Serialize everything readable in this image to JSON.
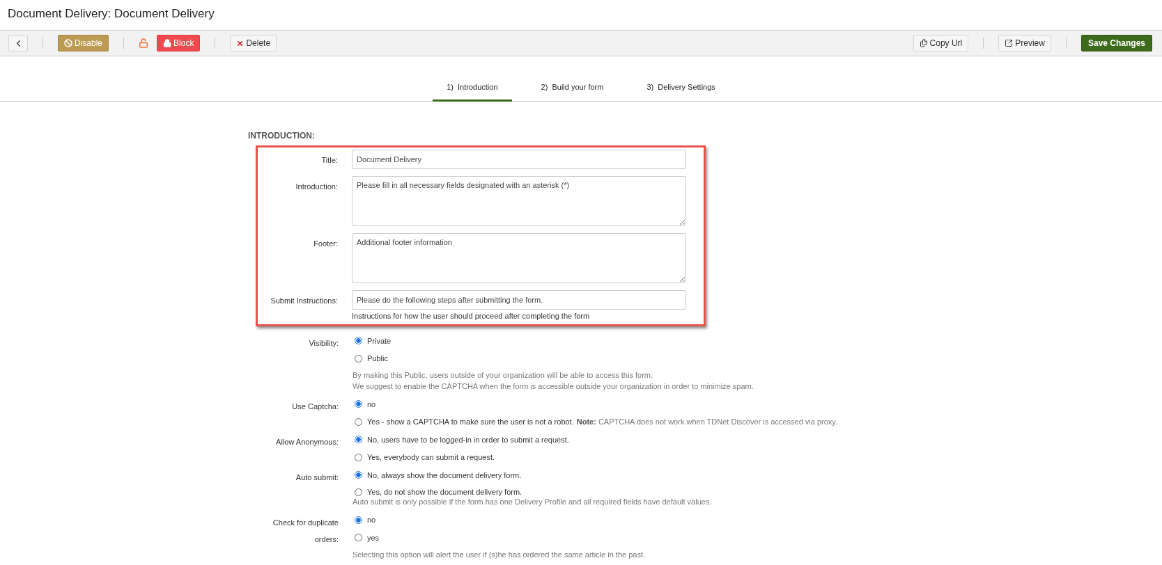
{
  "page_title": "Document Delivery: Document Delivery",
  "toolbar": {
    "left": [
      [
        {
          "kind": "back"
        }
      ],
      [
        {
          "kind": "disable",
          "label": "Disable"
        }
      ],
      [
        {
          "kind": "unlock"
        },
        {
          "kind": "block",
          "label": "Block"
        }
      ],
      [
        {
          "kind": "delete",
          "label": "Delete"
        }
      ]
    ],
    "right": [
      [
        {
          "kind": "copy",
          "label": "Copy Url"
        }
      ],
      [
        {
          "kind": "preview",
          "label": "Preview"
        }
      ],
      [
        {
          "kind": "save",
          "label": "Save Changes"
        }
      ]
    ]
  },
  "tabs": [
    {
      "label": "1)  Introduction",
      "selected": true
    },
    {
      "label": "2)  Build your form",
      "selected": false
    },
    {
      "label": "3)  Delivery Settings",
      "selected": false
    }
  ],
  "section_title": "INTRODUCTION:",
  "highlighted_fields": [
    {
      "kind": "input",
      "label": "Title:",
      "value": "Document Delivery"
    },
    {
      "kind": "textarea",
      "label": "Introduction:",
      "value": "Please fill in all necessary fields designated with an asterisk (*)"
    },
    {
      "kind": "textarea",
      "label": "Footer:",
      "value": "Additional footer information"
    },
    {
      "kind": "input",
      "label": "Submit Instructions:",
      "value": "Please do the following steps after submitting the form.",
      "help": "Instructions for how the user should proceed after completing the form"
    }
  ],
  "radio_groups": [
    {
      "label": "Visibility:",
      "options": [
        {
          "label": "Private",
          "selected": true
        },
        {
          "label": "Public",
          "selected": false
        }
      ],
      "help": [
        "By making this Public, users outside of your organization will be able to access this form.",
        "We suggest to enable the CAPTCHA when the form is accessible outside your organization in order to minimize spam."
      ]
    },
    {
      "label": "Use Captcha:",
      "options": [
        {
          "label": "no",
          "selected": true
        },
        {
          "label": "Yes - show a CAPTCHA to make sure the user is not a robot.",
          "note": "**Note:** CAPTCHA does not work when TDNet Discover is accessed via proxy.",
          "selected": false
        }
      ]
    },
    {
      "label": "Allow Anonymous:",
      "options": [
        {
          "label": "No, users have to be logged-in in order to submit a request.",
          "selected": true
        },
        {
          "label": "Yes, everybody can submit a request.",
          "selected": false
        }
      ]
    },
    {
      "label": "Auto submit:",
      "options": [
        {
          "label": "No, always show the document delivery form.",
          "selected": true
        },
        {
          "label": "Yes, do not show the document delivery form.",
          "selected": false
        }
      ],
      "help": [
        "Auto submit is only possible if the form has one Delivery Profile and all required fields have default values."
      ],
      "tight": true
    },
    {
      "label": "Check for duplicate orders:",
      "options": [
        {
          "label": "no",
          "selected": true
        },
        {
          "label": "yes",
          "selected": false
        }
      ],
      "help": [
        "Selecting this option will alert the user if (s)he has ordered the same article in the past."
      ]
    }
  ]
}
